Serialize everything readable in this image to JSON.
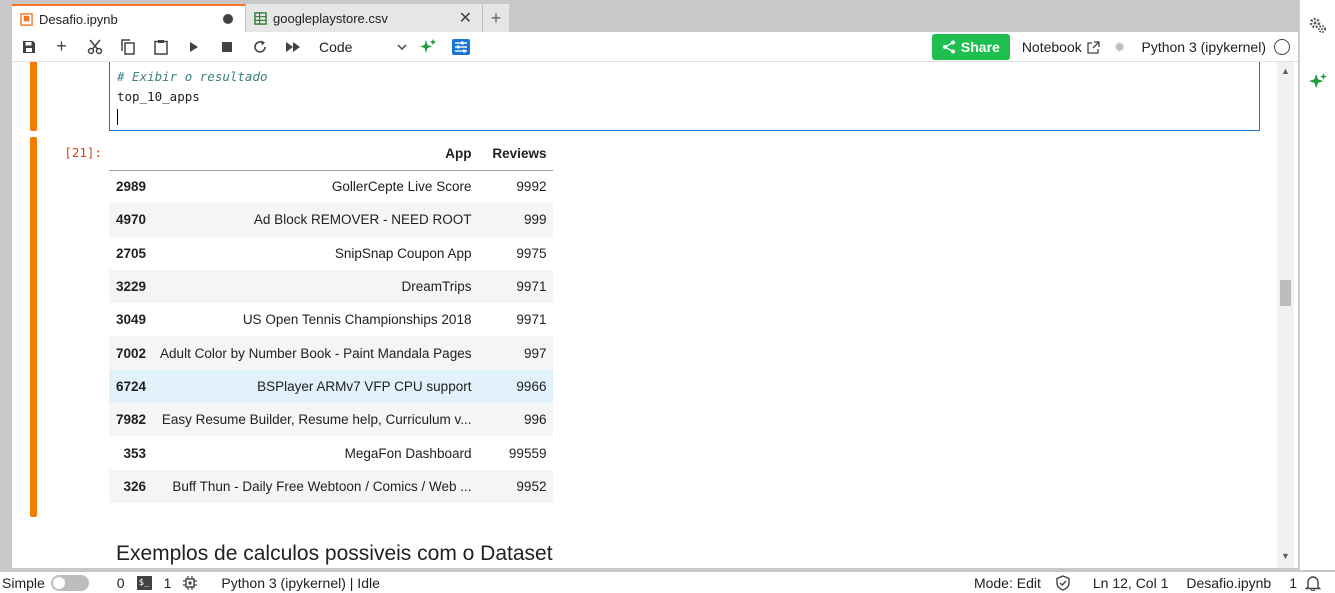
{
  "tabs": [
    {
      "title": "Desafio.ipynb",
      "icon": "notebook-icon",
      "modified": true,
      "active": true
    },
    {
      "title": "googleplaystore.csv",
      "icon": "spreadsheet-icon",
      "active": false
    }
  ],
  "toolbar": {
    "cell_type": "Code",
    "share_label": "Share",
    "notebook_label": "Notebook",
    "kernel": "Python 3 (ipykernel)"
  },
  "editor": {
    "lines": [
      "# Exibir o resultado",
      "top_10_apps"
    ]
  },
  "output": {
    "prompt": "[21]:",
    "columns": [
      "",
      "App",
      "Reviews"
    ],
    "rows": [
      {
        "index": "2989",
        "app": "GollerCepte Live Score",
        "reviews": "9992"
      },
      {
        "index": "4970",
        "app": "Ad Block REMOVER - NEED ROOT",
        "reviews": "999"
      },
      {
        "index": "2705",
        "app": "SnipSnap Coupon App",
        "reviews": "9975"
      },
      {
        "index": "3229",
        "app": "DreamTrips",
        "reviews": "9971"
      },
      {
        "index": "3049",
        "app": "US Open Tennis Championships 2018",
        "reviews": "9971"
      },
      {
        "index": "7002",
        "app": "Adult Color by Number Book - Paint Mandala Pages",
        "reviews": "997"
      },
      {
        "index": "6724",
        "app": "BSPlayer ARMv7 VFP CPU support",
        "reviews": "9966"
      },
      {
        "index": "7982",
        "app": "Easy Resume Builder, Resume help, Curriculum v...",
        "reviews": "996"
      },
      {
        "index": "353",
        "app": "MegaFon Dashboard",
        "reviews": "99559"
      },
      {
        "index": "326",
        "app": "Buff Thun - Daily Free Webtoon / Comics / Web ...",
        "reviews": "9952"
      }
    ]
  },
  "markdown": {
    "heading": "Exemplos de calculos possiveis com o Dataset"
  },
  "statusbar": {
    "simple_label": "Simple",
    "terminals": "0",
    "kernels": "1",
    "kernel_status": "Python 3 (ipykernel) | Idle",
    "mode": "Mode: Edit",
    "position": "Ln 12, Col 1",
    "filename": "Desafio.ipynb",
    "notifications": "1"
  },
  "colors": {
    "accent": "#f57c00",
    "share": "#1fbf4f",
    "editor_border": "#1976d2",
    "prompt": "#d84315"
  }
}
